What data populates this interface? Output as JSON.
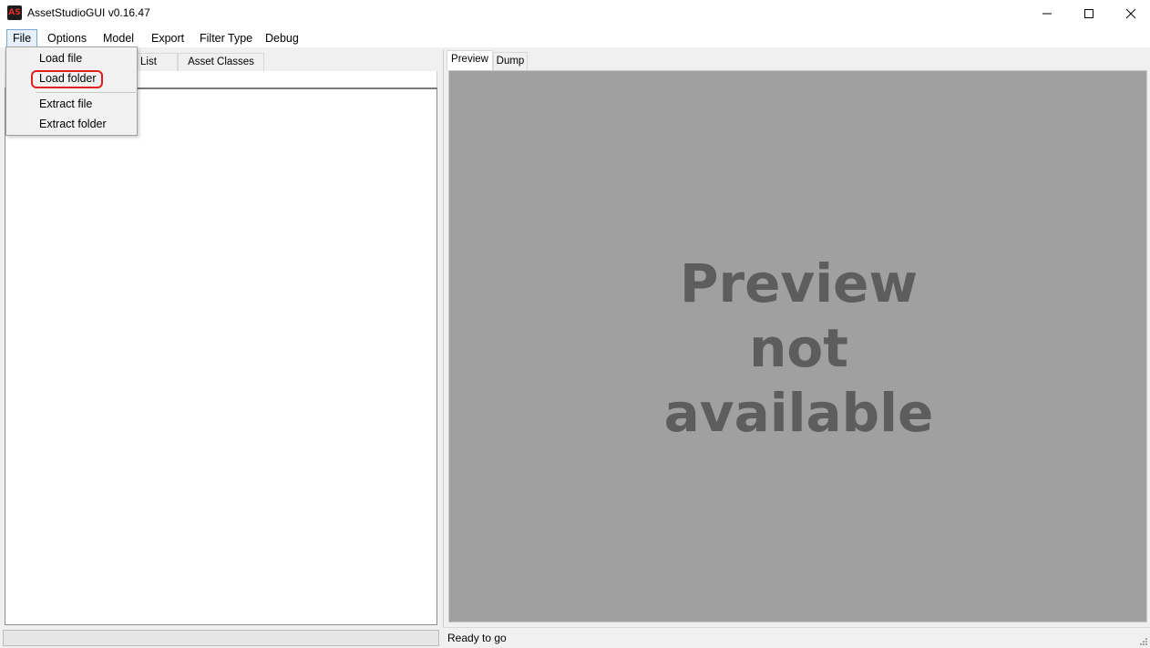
{
  "window": {
    "title": "AssetStudioGUI v0.16.47",
    "icon_glyph": "AS",
    "controls": {
      "minimize": "minimize-icon",
      "maximize": "maximize-icon",
      "close": "close-icon"
    }
  },
  "menubar": {
    "items": [
      "File",
      "Options",
      "Model",
      "Export",
      "Filter Type",
      "Debug"
    ]
  },
  "file_menu": {
    "items": [
      "Load file",
      "Load folder",
      "Extract file",
      "Extract folder"
    ],
    "highlighted": "Load folder"
  },
  "left_panel": {
    "tabs": [
      "List",
      "Asset Classes"
    ]
  },
  "right_panel": {
    "tabs": [
      "Preview",
      "Dump"
    ],
    "preview_message": [
      "Preview",
      "not",
      "available"
    ]
  },
  "status": {
    "text": "Ready to go"
  },
  "colors": {
    "preview_bg": "#a0a0a0",
    "preview_text": "#5d5d5d",
    "highlight": "#e0201c",
    "menu_active_bg": "#e5f0fb"
  }
}
